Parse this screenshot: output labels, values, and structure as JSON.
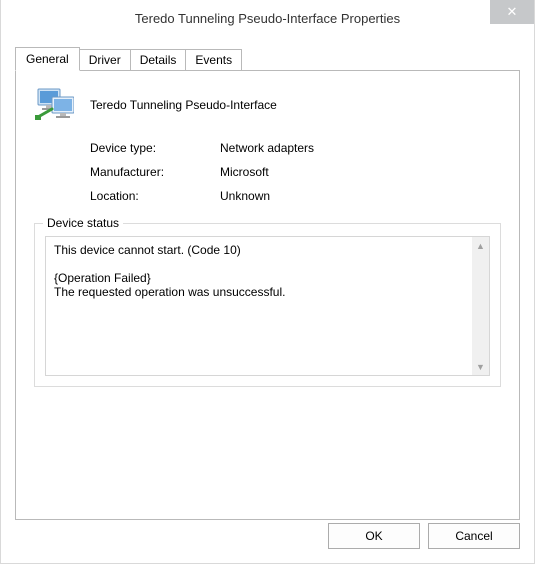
{
  "window": {
    "title": "Teredo Tunneling Pseudo-Interface Properties"
  },
  "tabs": [
    {
      "label": "General"
    },
    {
      "label": "Driver"
    },
    {
      "label": "Details"
    },
    {
      "label": "Events"
    }
  ],
  "device": {
    "name": "Teredo Tunneling Pseudo-Interface",
    "type_label": "Device type:",
    "type_value": "Network adapters",
    "manufacturer_label": "Manufacturer:",
    "manufacturer_value": "Microsoft",
    "location_label": "Location:",
    "location_value": "Unknown"
  },
  "status": {
    "legend": "Device status",
    "text": "This device cannot start. (Code 10)\n\n{Operation Failed}\nThe requested operation was unsuccessful."
  },
  "buttons": {
    "ok": "OK",
    "cancel": "Cancel"
  }
}
